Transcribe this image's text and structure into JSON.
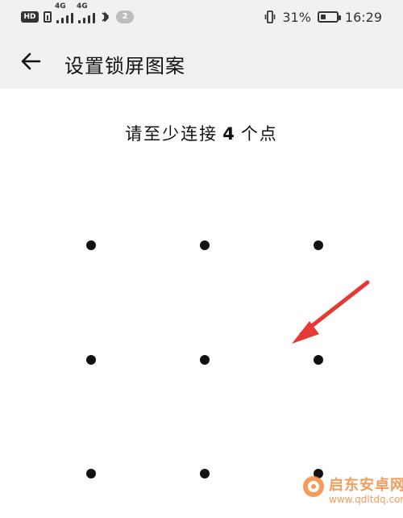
{
  "status_bar": {
    "hd_label": "HD",
    "net_label_1": "4G",
    "net_label_2": "4G",
    "notification_count": "2",
    "battery_percent": "31%",
    "battery_level": 0.31,
    "time": "16:29"
  },
  "header": {
    "title": "设置锁屏图案"
  },
  "main": {
    "instruction_prefix": "请至少连接",
    "instruction_number": "4",
    "instruction_suffix": "个点",
    "dots": [
      {
        "id": "1"
      },
      {
        "id": "2"
      },
      {
        "id": "3"
      },
      {
        "id": "4"
      },
      {
        "id": "5"
      },
      {
        "id": "6"
      },
      {
        "id": "7"
      },
      {
        "id": "8"
      },
      {
        "id": "9"
      }
    ]
  },
  "watermark": {
    "title": "启东安卓网",
    "url": "www.qdltdq.com"
  },
  "colors": {
    "header_bg": "#f1f1f1",
    "dot": "#111111",
    "arrow": "#e53935",
    "watermark": "#f28b42"
  },
  "icons": {
    "back": "arrow-left-icon",
    "bluetooth": "bluetooth-icon",
    "vibrate": "vibrate-icon",
    "battery": "battery-icon"
  }
}
